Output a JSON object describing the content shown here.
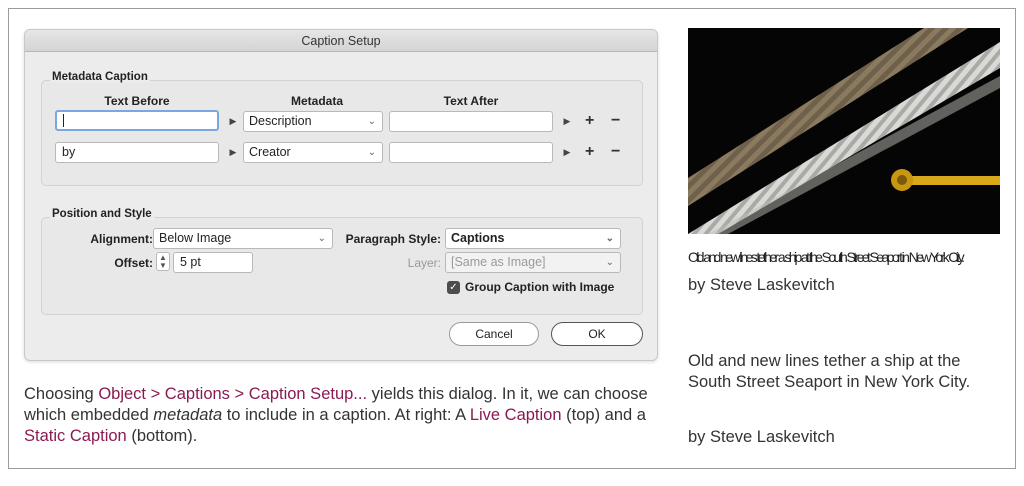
{
  "dialog": {
    "title": "Caption Setup",
    "metadata_group": {
      "label": "Metadata Caption",
      "col_text_before": "Text Before",
      "col_metadata": "Metadata",
      "col_text_after": "Text After",
      "rows": [
        {
          "text_before": "",
          "metadata": "Description",
          "text_after": ""
        },
        {
          "text_before": "by",
          "metadata": "Creator",
          "text_after": ""
        }
      ],
      "add_symbol": "+",
      "remove_symbol": "−",
      "arrow_symbol": "▶",
      "chevron_symbol": "⌄"
    },
    "position_group": {
      "label": "Position and Style",
      "alignment_label": "Alignment:",
      "alignment_value": "Below Image",
      "offset_label": "Offset:",
      "offset_value": "5 pt",
      "paragraph_style_label": "Paragraph Style:",
      "paragraph_style_value": "Captions",
      "layer_label": "Layer:",
      "layer_value": "[Same as Image]",
      "group_caption_label": "Group Caption with Image",
      "group_caption_checked": true
    },
    "cancel_label": "Cancel",
    "ok_label": "OK"
  },
  "description": {
    "p1": "Choosing ",
    "menu_path": "Object > Captions > Caption Setup...",
    "p2": " yields this dialog. In it, we can choose which embedded ",
    "metadata_word": "metadata",
    "p3": " to include in a caption. At right: A ",
    "live_caption": "Live Caption",
    "p4": " (top) and a ",
    "static_caption": "Static Caption",
    "p5": " (bottom)."
  },
  "right": {
    "live_caption_text": "Old and new lines tether a ship at the South Street Seaport in New York City.",
    "live_caption_byline": "by Steve Laskevitch",
    "static_caption_text": "Old and new lines tether a ship at the South Street Seaport in New York City.",
    "static_caption_byline": "by Steve Laskevitch"
  },
  "colors": {
    "highlight": "#8a1a52",
    "photo_background": "#050505",
    "rope_old": "#8a7a60",
    "rope_new": "#cfcfcf",
    "pipe_yellow": "#d8a81a"
  }
}
